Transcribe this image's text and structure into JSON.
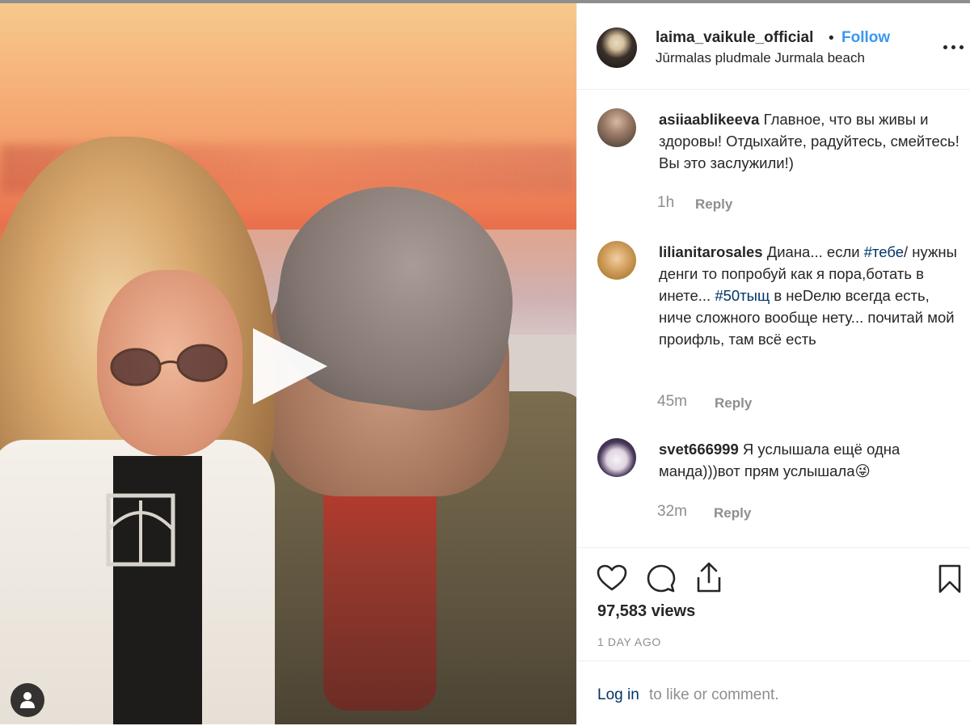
{
  "post": {
    "owner": {
      "username": "laima_vaikule_official",
      "separator": "•",
      "follow_label": "Follow",
      "location": "Jūrmalas pludmale Jurmala beach"
    },
    "comments": [
      {
        "username": "asiiaablikeeva",
        "parts": [
          "Главное, что вы живы и здоровы! Отдыхайте, радуйтесь, смейтесь! Вы это заслужили!)"
        ],
        "time": "1h",
        "reply_label": "Reply"
      },
      {
        "username": "lilianitarosales",
        "parts": [
          "Диана... если ",
          "#тебе",
          "/ нужны денги то попробуй как я пора,ботать в инете... ",
          "#50тыщ",
          " в неDелю всегда есть, ниче сложного вообще нету... почитай мой проифль, там всё есть"
        ],
        "time": "45m",
        "reply_label": "Reply"
      },
      {
        "username": "svet666999",
        "parts": [
          "Я услышала ещё одна манда)))вот прям услышала",
          "😜"
        ],
        "time": "32m",
        "reply_label": "Reply"
      }
    ],
    "views": "97,583 views",
    "date": "1 DAY AGO",
    "login": {
      "link": "Log in",
      "rest": "to like or comment."
    }
  },
  "icons": {
    "play": "play-icon",
    "user_tag": "person-icon",
    "more": "more-options-icon",
    "like": "heart-icon",
    "comment": "comment-bubble-icon",
    "share": "share-icon",
    "save": "bookmark-icon"
  },
  "colors": {
    "follow": "#3897f0",
    "link": "#003569",
    "muted": "#8e8e8e",
    "text": "#262626"
  }
}
